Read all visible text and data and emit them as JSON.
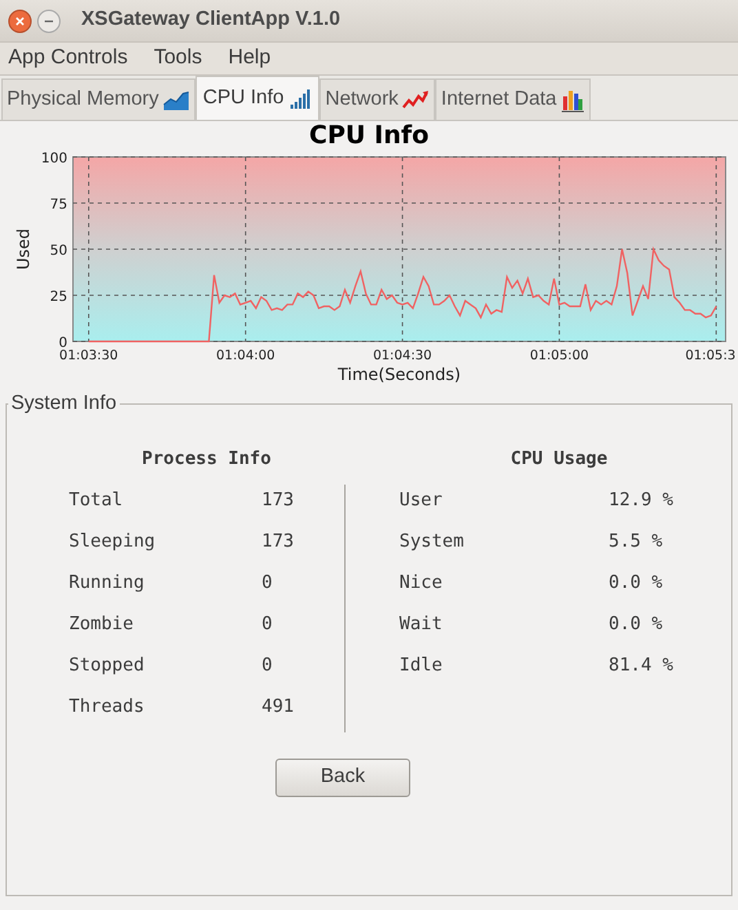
{
  "window": {
    "title": "XSGateway ClientApp V.1.0"
  },
  "menu": [
    "App Controls",
    "Tools",
    "Help"
  ],
  "tabs": [
    {
      "label": "Physical Memory",
      "selected": false
    },
    {
      "label": "CPU Info",
      "selected": true
    },
    {
      "label": "Network",
      "selected": false
    },
    {
      "label": "Internet Data",
      "selected": false
    }
  ],
  "chart": {
    "chart_data": {
      "type": "line",
      "grid": true,
      "title": "CPU Info",
      "xlabel": "Time(Seconds)",
      "ylabel": "Used",
      "xlim": [
        3807,
        3931.8
      ],
      "ylim": [
        0,
        100
      ],
      "xticks": [
        {
          "value": 3810,
          "label": "01:03:30"
        },
        {
          "value": 3840,
          "label": "01:04:00"
        },
        {
          "value": 3870,
          "label": "01:04:30"
        },
        {
          "value": 3900,
          "label": "01:05:00"
        },
        {
          "value": 3930,
          "label": "01:05:3"
        }
      ],
      "yticks": [
        0,
        25,
        50,
        75,
        100
      ],
      "x": [
        3810,
        3833,
        3834,
        3835,
        3836,
        3837,
        3838,
        3839,
        3840,
        3841,
        3842,
        3843,
        3844,
        3845,
        3846,
        3847,
        3848,
        3849,
        3850,
        3851,
        3852,
        3853,
        3854,
        3855,
        3856,
        3857,
        3858,
        3859,
        3860,
        3861,
        3862,
        3863,
        3864,
        3865,
        3866,
        3867,
        3868,
        3869,
        3870,
        3871,
        3872,
        3873,
        3874,
        3875,
        3876,
        3877,
        3878,
        3879,
        3880,
        3881,
        3882,
        3883,
        3884,
        3885,
        3886,
        3887,
        3888,
        3889,
        3890,
        3891,
        3892,
        3893,
        3894,
        3895,
        3896,
        3897,
        3898,
        3899,
        3900,
        3901,
        3902,
        3903,
        3904,
        3905,
        3906,
        3907,
        3908,
        3909,
        3910,
        3911,
        3912,
        3913,
        3914,
        3915,
        3916,
        3917,
        3918,
        3919,
        3920,
        3921,
        3922,
        3923,
        3924,
        3925,
        3926,
        3927,
        3928,
        3929,
        3930
      ],
      "series": [
        {
          "color": "#f06262",
          "values": [
            0,
            0,
            36,
            21,
            25,
            24,
            26,
            20,
            21,
            22,
            18,
            24,
            22,
            17,
            18,
            17,
            20,
            20,
            26,
            24,
            27,
            25,
            18,
            19,
            19,
            17,
            19,
            28,
            21,
            30,
            38,
            26,
            20,
            20,
            28,
            23,
            25,
            21,
            20,
            21,
            18,
            26,
            35,
            30,
            20,
            20,
            22,
            25,
            19,
            14,
            22,
            20,
            18,
            13,
            20,
            15,
            17,
            16,
            35,
            29,
            33,
            26,
            34,
            24,
            25,
            22,
            20,
            34,
            20,
            21,
            19,
            19,
            19,
            31,
            17,
            22,
            20,
            22,
            20,
            30,
            50,
            37,
            14,
            22,
            30,
            23,
            50,
            44,
            41,
            39,
            24,
            21,
            17,
            17,
            15,
            15,
            13,
            14,
            19
          ]
        }
      ]
    }
  },
  "system_info": {
    "title": "System Info",
    "process_info": {
      "heading": "Process Info",
      "rows": [
        {
          "label": "Total",
          "value": "173"
        },
        {
          "label": "Sleeping",
          "value": "173"
        },
        {
          "label": "Running",
          "value": "0"
        },
        {
          "label": "Zombie",
          "value": "0"
        },
        {
          "label": "Stopped",
          "value": "0"
        },
        {
          "label": "Threads",
          "value": "491"
        }
      ]
    },
    "cpu_usage": {
      "heading": "CPU Usage",
      "rows": [
        {
          "label": "User",
          "value": "12.9 %"
        },
        {
          "label": "System",
          "value": "5.5 %"
        },
        {
          "label": "Nice",
          "value": "0.0 %"
        },
        {
          "label": "Wait",
          "value": "0.0 %"
        },
        {
          "label": "Idle",
          "value": "81.4 %"
        }
      ]
    }
  },
  "buttons": [
    "Back"
  ]
}
